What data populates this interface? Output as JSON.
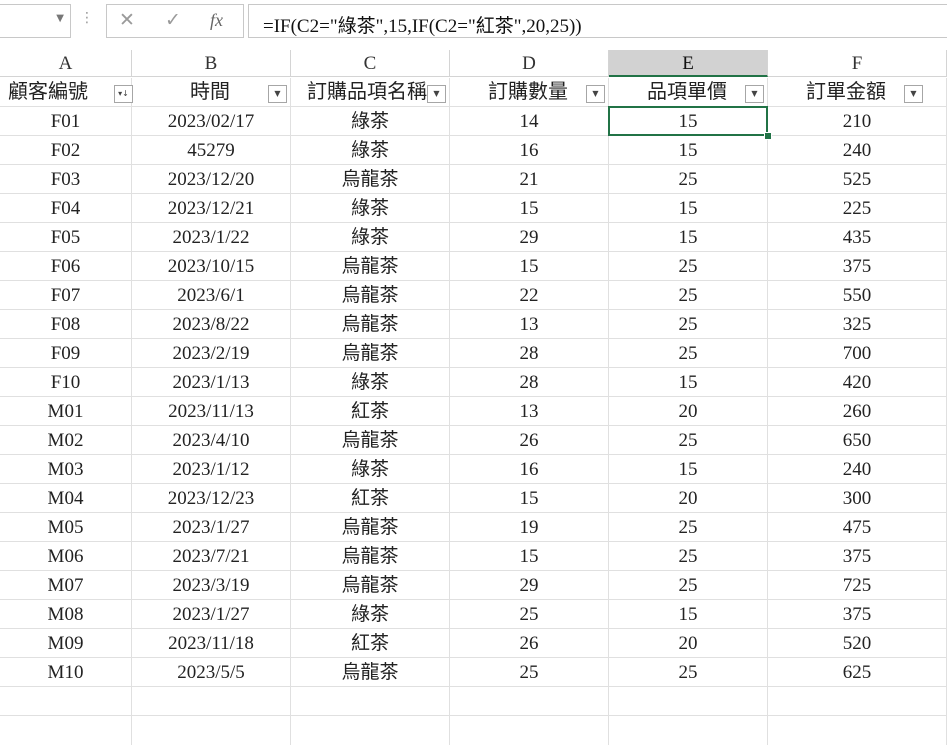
{
  "formula_bar": {
    "name_box": "",
    "cancel_icon": "✕",
    "enter_icon": "✓",
    "fx_label": "fx",
    "formula": "=IF(C2=\"綠茶\",15,IF(C2=\"紅茶\",20,25))"
  },
  "columns": [
    "A",
    "B",
    "C",
    "D",
    "E",
    "F"
  ],
  "selected_column": "E",
  "headers": [
    "顧客編號",
    "時間",
    "訂購品項名稱",
    "訂購數量",
    "品項單價",
    "訂單金額"
  ],
  "rows": [
    [
      "F01",
      "2023/02/17",
      "綠茶",
      "14",
      "15",
      "210"
    ],
    [
      "F02",
      "45279",
      "綠茶",
      "16",
      "15",
      "240"
    ],
    [
      "F03",
      "2023/12/20",
      "烏龍茶",
      "21",
      "25",
      "525"
    ],
    [
      "F04",
      "2023/12/21",
      "綠茶",
      "15",
      "15",
      "225"
    ],
    [
      "F05",
      "2023/1/22",
      "綠茶",
      "29",
      "15",
      "435"
    ],
    [
      "F06",
      "2023/10/15",
      "烏龍茶",
      "15",
      "25",
      "375"
    ],
    [
      "F07",
      "2023/6/1",
      "烏龍茶",
      "22",
      "25",
      "550"
    ],
    [
      "F08",
      "2023/8/22",
      "烏龍茶",
      "13",
      "25",
      "325"
    ],
    [
      "F09",
      "2023/2/19",
      "烏龍茶",
      "28",
      "25",
      "700"
    ],
    [
      "F10",
      "2023/1/13",
      "綠茶",
      "28",
      "15",
      "420"
    ],
    [
      "M01",
      "2023/11/13",
      "紅茶",
      "13",
      "20",
      "260"
    ],
    [
      "M02",
      "2023/4/10",
      "烏龍茶",
      "26",
      "25",
      "650"
    ],
    [
      "M03",
      "2023/1/12",
      "綠茶",
      "16",
      "15",
      "240"
    ],
    [
      "M04",
      "2023/12/23",
      "紅茶",
      "15",
      "20",
      "300"
    ],
    [
      "M05",
      "2023/1/27",
      "烏龍茶",
      "19",
      "25",
      "475"
    ],
    [
      "M06",
      "2023/7/21",
      "烏龍茶",
      "15",
      "25",
      "375"
    ],
    [
      "M07",
      "2023/3/19",
      "烏龍茶",
      "29",
      "25",
      "725"
    ],
    [
      "M08",
      "2023/1/27",
      "綠茶",
      "25",
      "15",
      "375"
    ],
    [
      "M09",
      "2023/11/18",
      "紅茶",
      "26",
      "20",
      "520"
    ],
    [
      "M10",
      "2023/5/5",
      "烏龍茶",
      "25",
      "25",
      "625"
    ]
  ],
  "colors": {
    "accent": "#217346",
    "selected_header": "#d2d2d2",
    "gridline": "#e0e0e0"
  }
}
